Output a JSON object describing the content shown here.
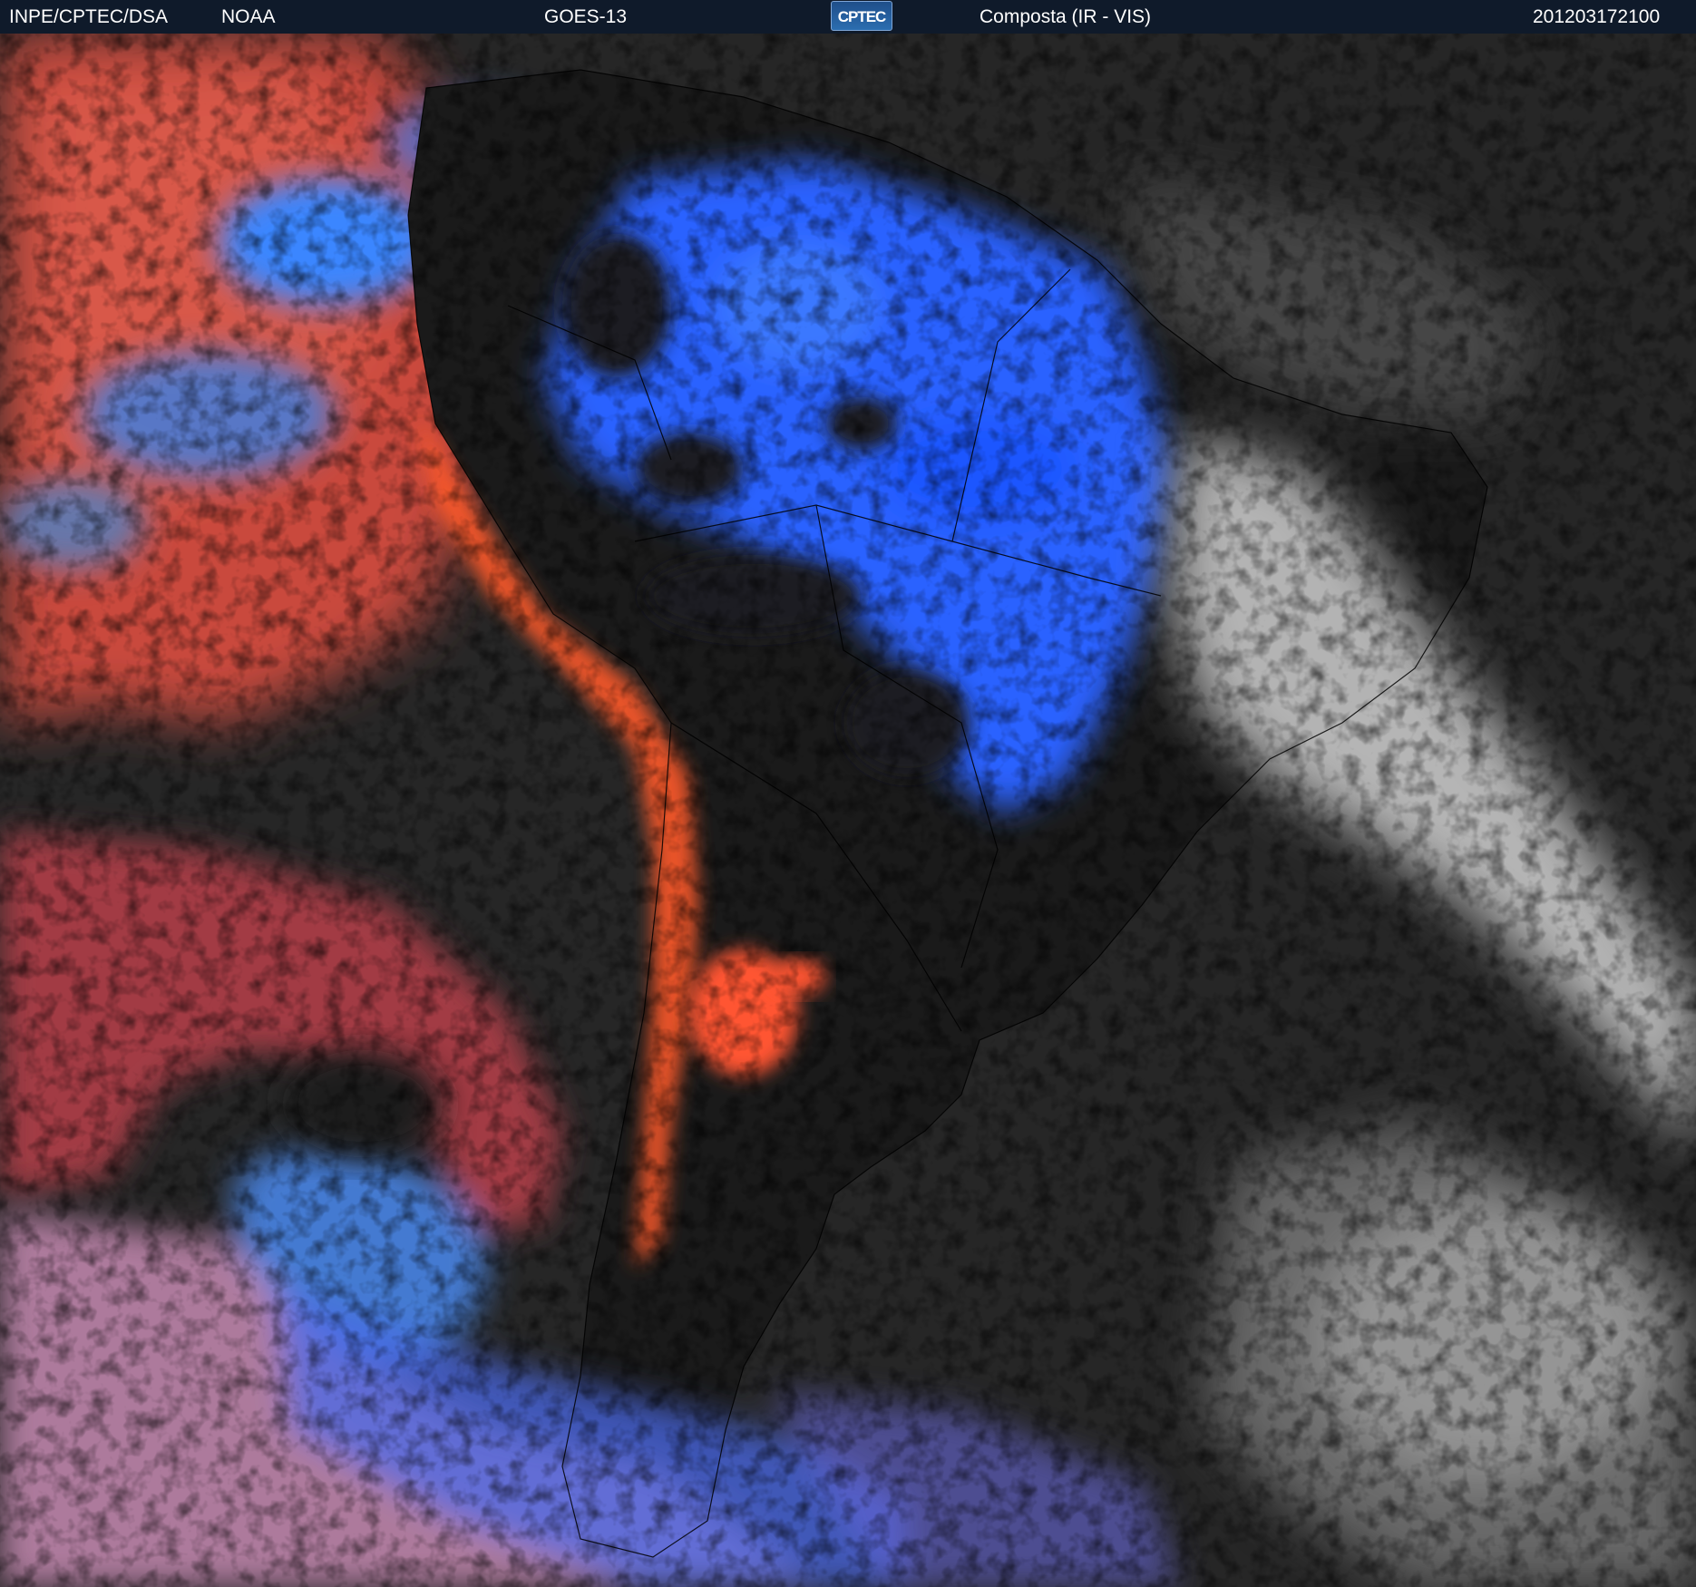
{
  "header": {
    "agency": "INPE/CPTEC/DSA",
    "partner": "NOAA",
    "satellite": "GOES-13",
    "logo_text": "CPTEC",
    "product": "Composta (IR - VIS)",
    "timestamp": "201203172100"
  },
  "image": {
    "subject": "satellite composite image of South America",
    "colors": {
      "ocean_dark": "#262626",
      "land_dark": "#1a1a1a",
      "high_cloud_blue": "#2a62ff",
      "low_cloud_red": "#d65040",
      "andes_orange": "#ff5a2a",
      "vis_cloud_white": "#d8d8d8",
      "pink_cloud": "#c87a9a",
      "outline": "#000000"
    }
  }
}
